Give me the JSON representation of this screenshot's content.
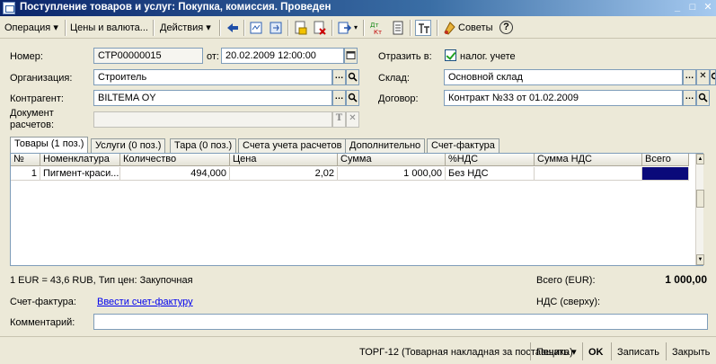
{
  "window": {
    "title": "Поступление товаров и услуг: Покупка, комиссия. Проведен",
    "min": "_",
    "max": "□",
    "close": "✕"
  },
  "toolbar": {
    "operation": "Операция ▾",
    "prices": "Цены и валюта...",
    "actions": "Действия ▾",
    "tips": "Советы",
    "help": "?"
  },
  "form": {
    "number_label": "Номер:",
    "number_value": "СТР00000015",
    "from_label": "от:",
    "date_value": "20.02.2009 12:00:00",
    "reflect_label": "Отразить в:",
    "tax_label": "налог. учете",
    "org_label": "Организация:",
    "org_value": "Строитель",
    "warehouse_label": "Склад:",
    "warehouse_value": "Основной склад",
    "counterparty_label": "Контрагент:",
    "counterparty_value": "BILTEMA OY",
    "contract_label": "Договор:",
    "contract_value": "Контракт №33 от 01.02.2009",
    "settlement_doc_label_1": "Документ",
    "settlement_doc_label_2": "расчетов:",
    "settlement_doc_value": ""
  },
  "tabs": [
    {
      "label": "Товары (1 поз.)"
    },
    {
      "label": "Услуги (0 поз.)"
    },
    {
      "label": "Тара (0 поз.)"
    },
    {
      "label": "Счета учета расчетов"
    },
    {
      "label": "Дополнительно"
    },
    {
      "label": "Счет-фактура"
    }
  ],
  "table": {
    "columns": [
      "№",
      "Номенклатура",
      "Количество",
      "Цена",
      "Сумма",
      "%НДС",
      "Сумма НДС",
      "Всего"
    ],
    "rows": [
      {
        "n": "1",
        "item": "Пигмент-краси...",
        "qty": "494,000",
        "price": "2,02",
        "sum": "1 000,00",
        "vat_rate": "Без НДС",
        "vat_sum": "",
        "total": ""
      }
    ]
  },
  "summary": {
    "rate_info": "1 EUR = 43,6 RUB, Тип цен: Закупочная",
    "total_label": "Всего (EUR):",
    "total_value": "1 000,00",
    "invoice_label": "Счет-фактура:",
    "invoice_link": "Ввести счет-фактуру",
    "vat_label": "НДС (сверху):",
    "comment_label": "Комментарий:",
    "comment_value": ""
  },
  "bottom": {
    "torg": "ТОРГ-12 (Товарная накладная за поставщика)",
    "print": "Печать ▾",
    "ok": "OK",
    "save": "Записать",
    "close": "Закрыть"
  },
  "colors": {
    "title_bar": "#0a246a",
    "selected_cell": "#0a0a7a",
    "link": "#0000ee"
  }
}
